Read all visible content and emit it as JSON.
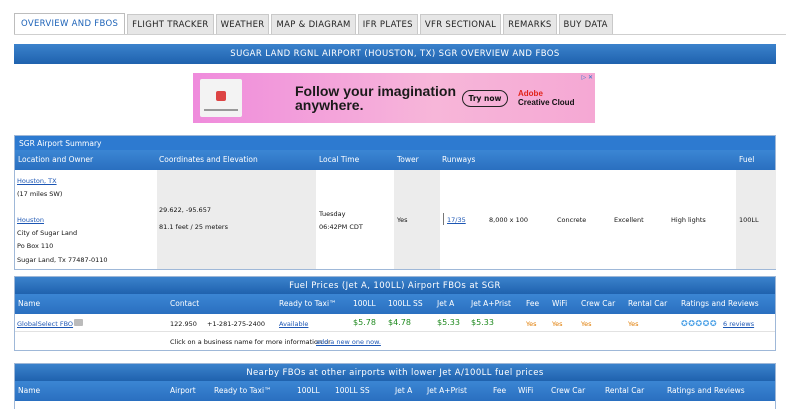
{
  "tabs": [
    {
      "label": "OVERVIEW AND FBOS",
      "active": true
    },
    {
      "label": "FLIGHT TRACKER"
    },
    {
      "label": "WEATHER"
    },
    {
      "label": "MAP & DIAGRAM"
    },
    {
      "label": "IFR PLATES"
    },
    {
      "label": "VFR SECTIONAL"
    },
    {
      "label": "REMARKS"
    },
    {
      "label": "BUY DATA"
    }
  ],
  "page_title": "SUGAR LAND RGNL AIRPORT (HOUSTON, TX) SGR OVERVIEW AND FBOS",
  "ad": {
    "headline": "Follow your imagination anywhere.",
    "button": "Try now",
    "brand_line1": "Adobe",
    "brand_line2": "Creative Cloud",
    "info": "▷ ✕"
  },
  "summary": {
    "title": "SGR Airport Summary",
    "columns": [
      "Location and Owner",
      "Coordinates and Elevation",
      "Local Time",
      "Tower",
      "Runways",
      "Fuel"
    ],
    "location_link": "Houston, TX",
    "distance": "(17 miles SW)",
    "owner_link": "Houston",
    "owner_lines": [
      "City of Sugar Land",
      "Po Box 110",
      "Sugar Land, Tx 77487-0110"
    ],
    "coordinates": "29.622, -95.657",
    "elevation": "81.1 feet / 25 meters",
    "local_day": "Tuesday",
    "local_time": "06:42PM CDT",
    "tower": "Yes",
    "runway_id": "17/35",
    "runway_size": "8,000 x 100",
    "runway_surface": "Concrete",
    "runway_condition": "Excellent",
    "runway_lights": "High lights",
    "fuel": "100LL"
  },
  "fuel_section": {
    "title": "Fuel Prices (Jet A, 100LL) Airport FBOs at SGR",
    "columns": [
      "Name",
      "Contact",
      "Ready to Taxi™",
      "100LL",
      "100LL SS",
      "Jet A",
      "Jet A+Prist",
      "Fee",
      "WiFi",
      "Crew Car",
      "Rental Car",
      "Ratings and Reviews"
    ],
    "row": {
      "name": "GlobalSelect FBO",
      "freq": "122.950",
      "phone": "+1-281-275-2400",
      "taxi": "Available",
      "p100ll": "$5.78",
      "p100llss": "$4.78",
      "jeta": "$5.33",
      "jetaprist": "$5.33",
      "fee": "Yes",
      "wifi": "Yes",
      "crewcar": "Yes",
      "rentalcar": "Yes",
      "stars": "✪✪✪✪✪",
      "reviews": "6 reviews"
    },
    "note_text": "Click on a business name for more information or ",
    "note_link": "add a new one now."
  },
  "nearby_section": {
    "title": "Nearby FBOs at other airports with lower Jet A/100LL fuel prices",
    "columns": [
      "Name",
      "Airport",
      "Ready to Taxi™",
      "100LL",
      "100LL SS",
      "Jet A",
      "Jet A+Prist",
      "Fee",
      "WiFi",
      "Crew Car",
      "Rental Car",
      "Ratings and Reviews"
    ]
  },
  "colors": {
    "header_blue": "#2a6fc0",
    "price_green": "#1f8a1f",
    "yes_orange": "#e07b00",
    "link_blue": "#1c56b4"
  }
}
